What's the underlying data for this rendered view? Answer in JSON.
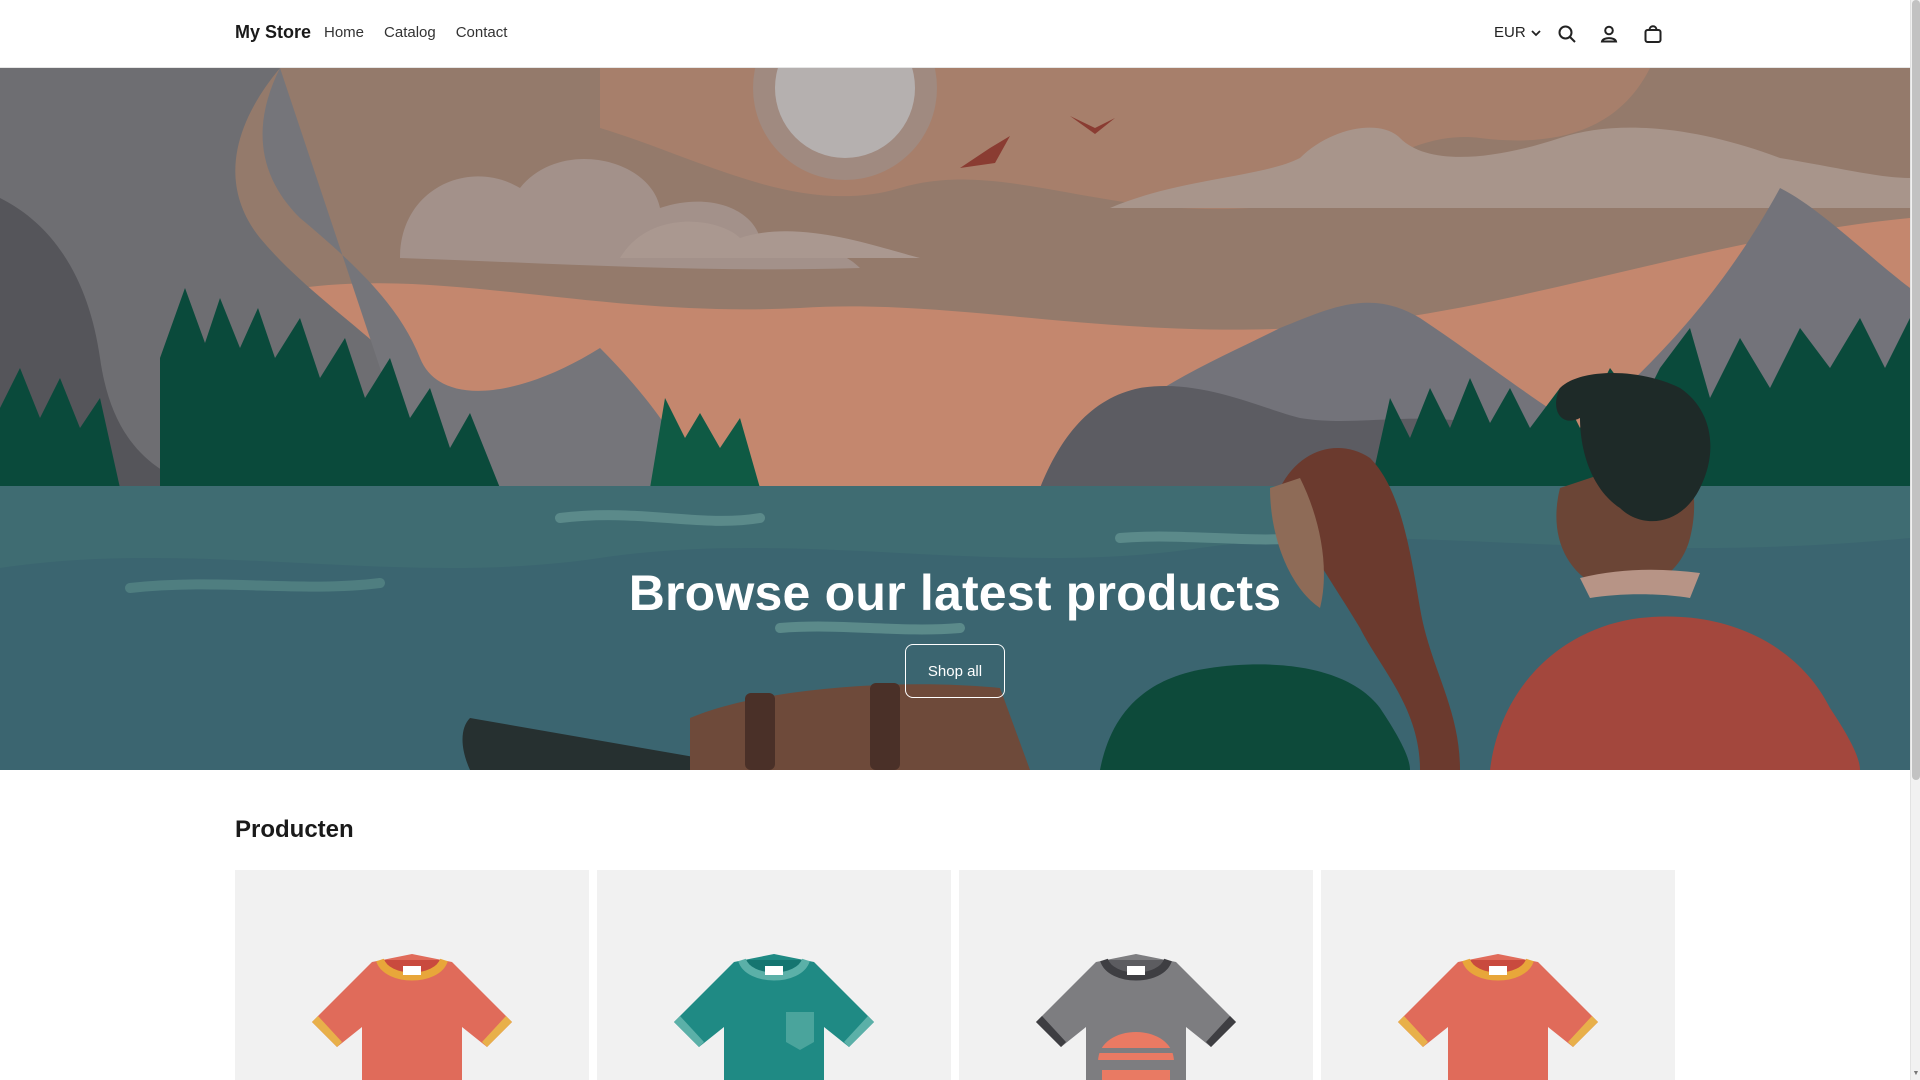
{
  "header": {
    "logo": "My Store",
    "nav": [
      "Home",
      "Catalog",
      "Contact"
    ],
    "currency": "EUR",
    "icons": [
      "search-icon",
      "account-icon",
      "cart-icon"
    ]
  },
  "hero": {
    "title": "Browse our latest products",
    "button_label": "Shop all"
  },
  "products": {
    "title": "Producten",
    "items": [
      {
        "icon": "tshirt-red-icon",
        "color": "#e06b5a"
      },
      {
        "icon": "tshirt-teal-icon",
        "color": "#1f8a84"
      },
      {
        "icon": "tshirt-grey-icon",
        "color": "#7d7d80"
      },
      {
        "icon": "tshirt-red-icon",
        "color": "#e06b5a"
      }
    ]
  }
}
